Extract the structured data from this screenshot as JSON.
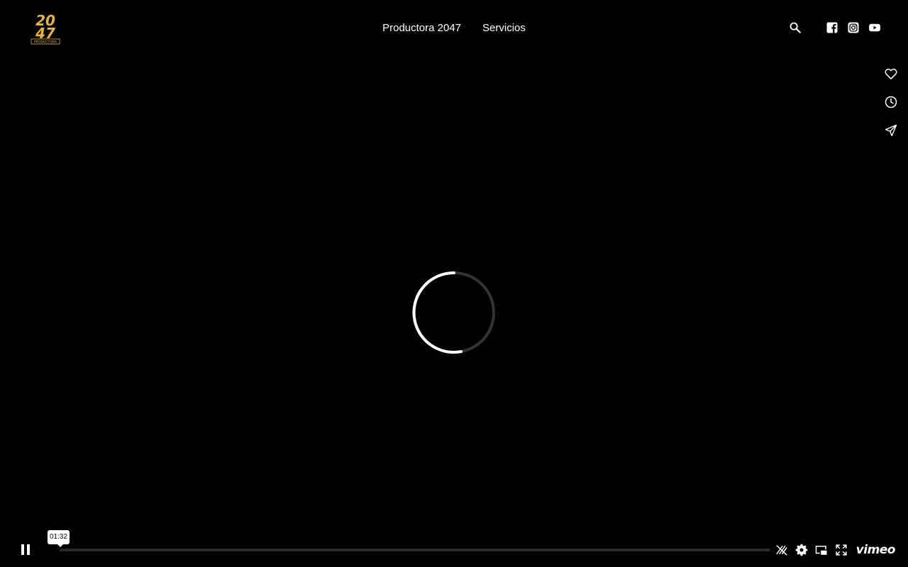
{
  "header": {
    "logo": {
      "text_top": "20",
      "text_bottom": "47",
      "caption": "PRODUCTORA",
      "color": "#e8b531"
    },
    "nav": [
      {
        "label": "Productora 2047"
      },
      {
        "label": "Servicios"
      }
    ],
    "icons": [
      "search-icon",
      "facebook-icon",
      "instagram-icon",
      "youtube-icon"
    ]
  },
  "side_actions": [
    "heart-icon",
    "clock-icon",
    "send-icon"
  ],
  "player": {
    "state": "loading",
    "time_tooltip": "01:32",
    "progress_fraction": 0.0,
    "controls_right": [
      "hd-off-icon",
      "settings-icon",
      "pip-icon",
      "fullscreen-icon"
    ],
    "brand": "vimeo"
  },
  "colors": {
    "background": "#000000",
    "accent": "#e8b531",
    "progress_track": "#2a2a2a",
    "spinner_track": "#333333",
    "foreground": "#ffffff"
  }
}
